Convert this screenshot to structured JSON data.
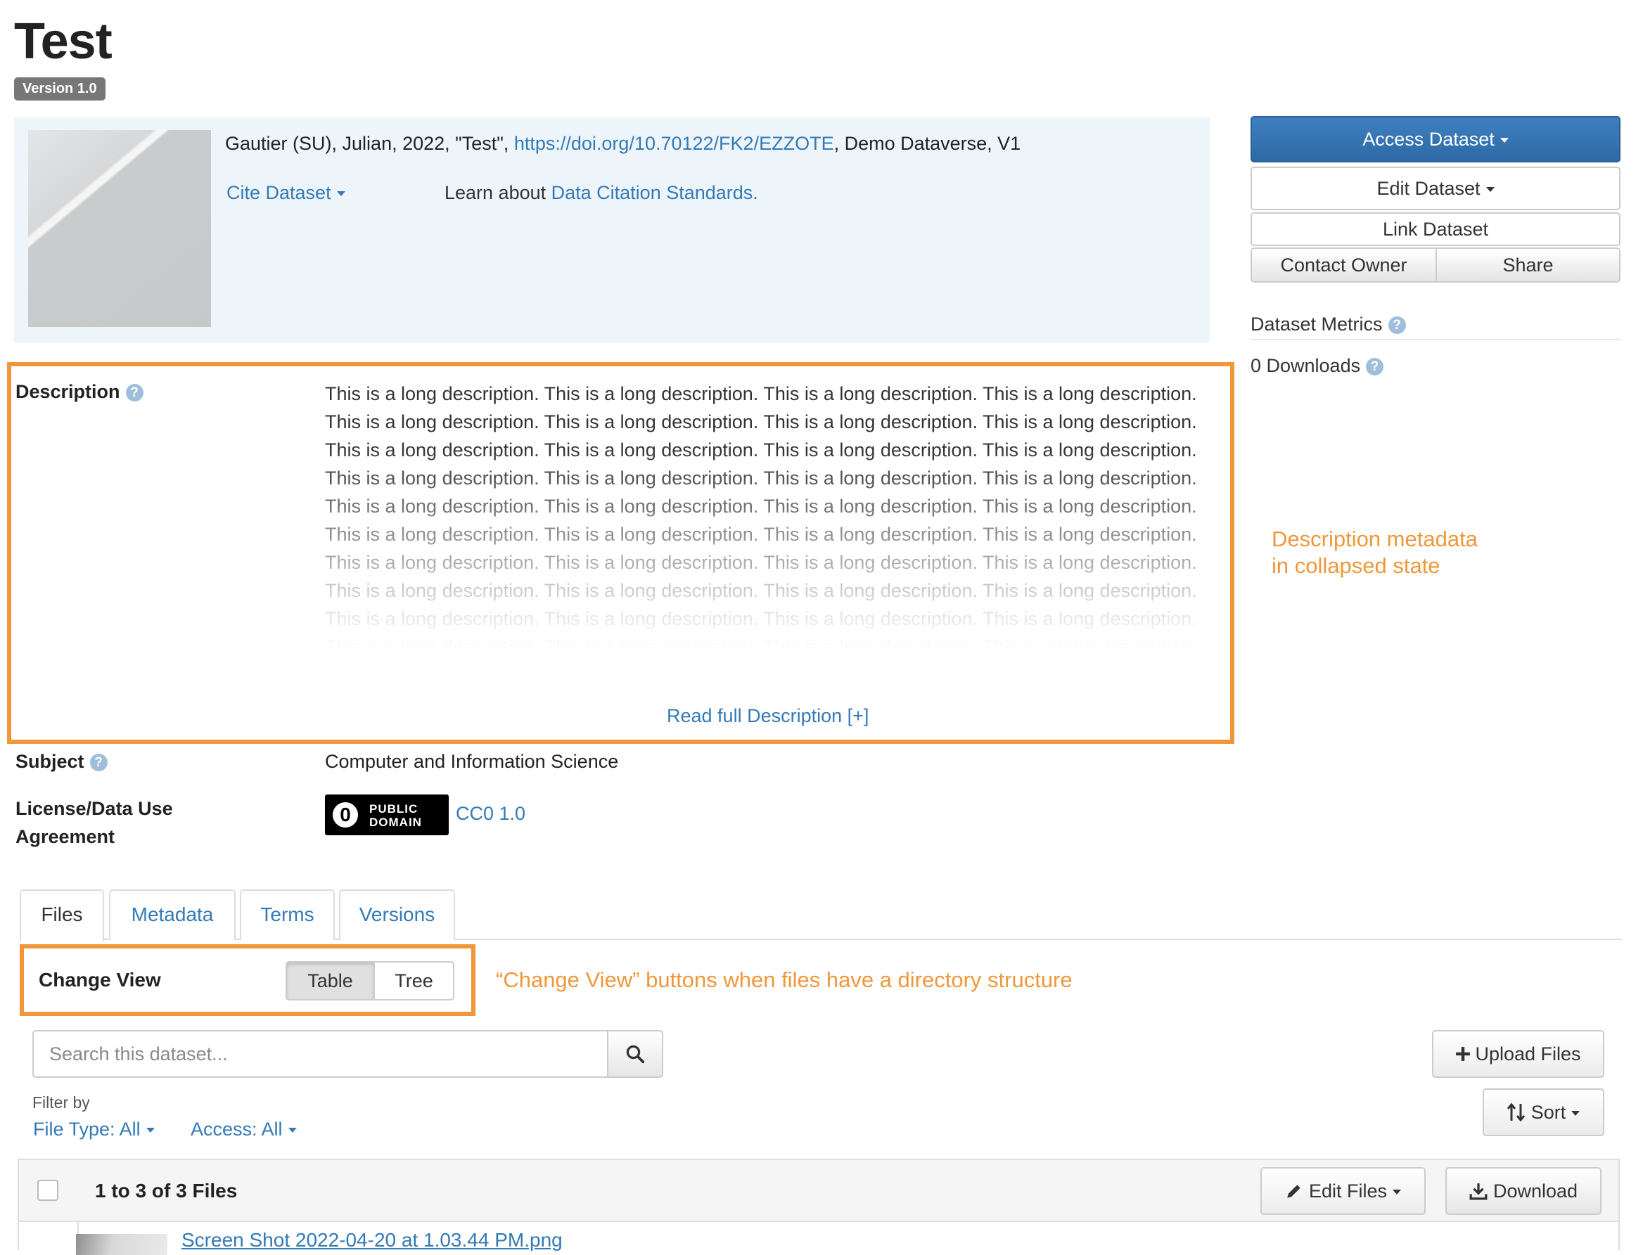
{
  "dataset": {
    "title": "Test",
    "version": "Version 1.0"
  },
  "citation": {
    "text_before": "Gautier (SU), Julian, 2022, \"Test\", ",
    "doi": "https://doi.org/10.70122/FK2/EZZOTE",
    "text_after": ", Demo Dataverse, V1",
    "cite_button": "Cite Dataset",
    "learn_prefix": "Learn about ",
    "learn_link": "Data Citation Standards."
  },
  "actions": {
    "access": "Access Dataset",
    "edit": "Edit Dataset",
    "link": "Link Dataset",
    "contact": "Contact Owner",
    "share": "Share"
  },
  "metrics": {
    "title": "Dataset Metrics",
    "downloads": "0 Downloads"
  },
  "description": {
    "label": "Description",
    "text": "This is a long description. This is a long description. This is a long description. This is a long description. This is a long description. This is a long description. This is a long description. This is a long description. This is a long description. This is a long description. This is a long description. This is a long description. This is a long description. This is a long description. This is a long description. This is a long description. This is a long description. This is a long description. This is a long description. This is a long description. This is a long description. This is a long description. This is a long description. This is a long description. This is a long description. This is a long description. This is a long description. This is a long description. This is a long description. This is a long description. This is a long description. This is a long description. This is a long description. This is a long description. This is a long description. This is a long description. This is a long description. This is a long description. This is a long description. This is a long description. This is a long description. This is a long description. This is a long description. This is a long description.",
    "read_full": "Read full Description [+]"
  },
  "subject": {
    "label": "Subject",
    "value": "Computer and Information Science"
  },
  "license": {
    "label": "License/Data Use Agreement",
    "badge_line1": "PUBLIC",
    "badge_line2": "DOMAIN",
    "link": "CC0 1.0"
  },
  "annotations": {
    "description_note": "Description metadata in collapsed state",
    "change_view_note": "“Change View” buttons when files have a directory structure",
    "color": "#f0973a"
  },
  "tabs": [
    {
      "label": "Files"
    },
    {
      "label": "Metadata"
    },
    {
      "label": "Terms"
    },
    {
      "label": "Versions"
    }
  ],
  "change_view": {
    "label": "Change View",
    "table": "Table",
    "tree": "Tree"
  },
  "files": {
    "search_placeholder": "Search this dataset...",
    "upload": "Upload Files",
    "filter_label": "Filter by",
    "file_type": "File Type: All",
    "access": "Access: All",
    "sort": "Sort",
    "count": "1 to 3 of 3 Files",
    "edit_files": "Edit Files",
    "download": "Download",
    "first_file": "Screen Shot 2022-04-20 at 1.03.44 PM.png"
  },
  "colors": {
    "link": "#337ab7",
    "primary": "#2d6aa6",
    "highlight": "#f0973a"
  }
}
